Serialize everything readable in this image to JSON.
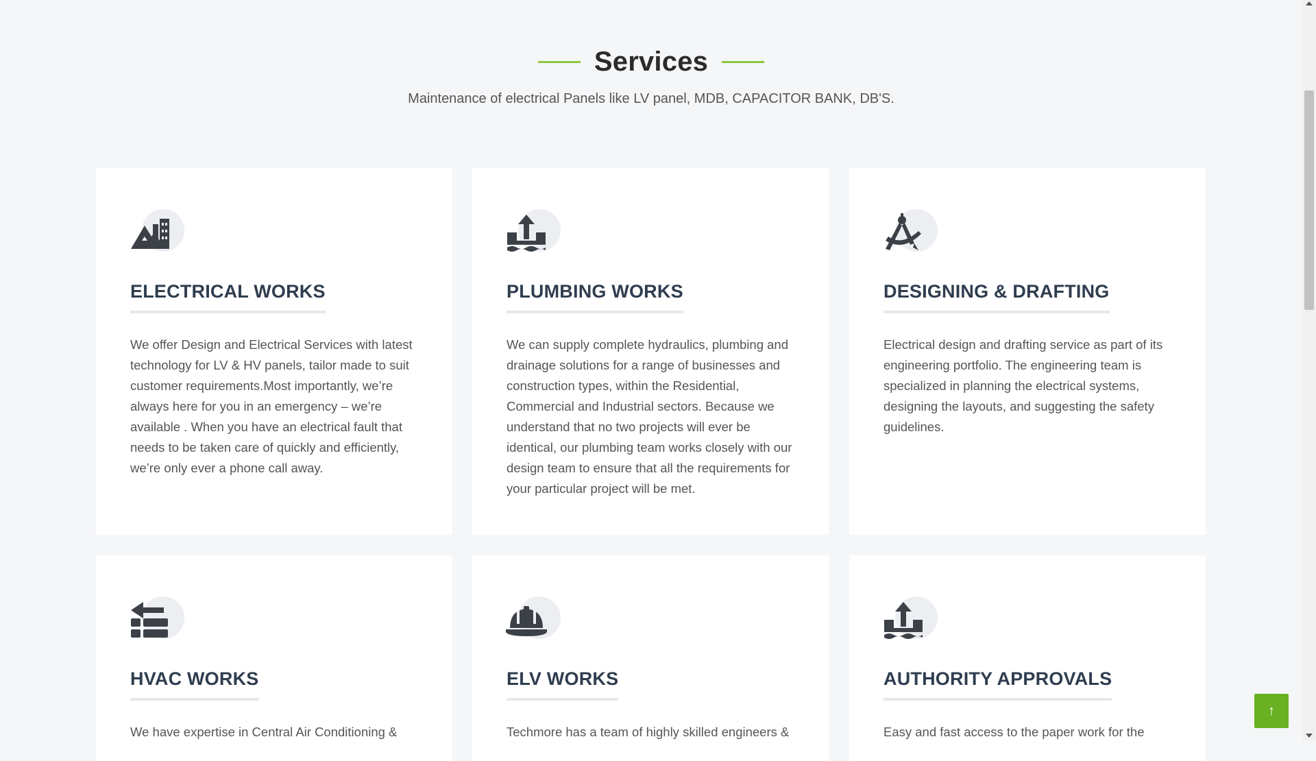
{
  "section": {
    "title": "Services",
    "subtitle": "Maintenance of electrical Panels like LV panel, MDB, CAPACITOR BANK, DB'S."
  },
  "services": [
    {
      "icon": "mountain-buildings-icon",
      "title": "ELECTRICAL WORKS",
      "description": "We offer Design and Electrical Services with latest technology for LV & HV panels, tailor made to suit customer requirements.Most importantly, we’re always here for you in an emergency – we’re available . When you have an electrical fault that needs to be taken care of quickly and efficiently, we’re only ever a phone call away."
    },
    {
      "icon": "water-upload-icon",
      "title": "PLUMBING WORKS",
      "description": "We can supply complete hydraulics, plumbing and drainage solutions for a range of businesses and construction types, within the Residential, Commercial and Industrial sectors. Because we understand that no two projects will ever be identical, our plumbing team works closely with our design team to ensure that all the requirements for your particular project will be met."
    },
    {
      "icon": "drafting-compass-icon",
      "title": "DESIGNING & DRAFTING",
      "description": "Electrical design and drafting service as part of its engineering portfolio. The engineering team is specialized in planning the electrical systems, designing the layouts, and suggesting the safety guidelines."
    },
    {
      "icon": "trowel-bricks-icon",
      "title": "HVAC WORKS",
      "description": "We have expertise in Central Air Conditioning &"
    },
    {
      "icon": "hard-hat-icon",
      "title": "ELV WORKS",
      "description": "Techmore has a team of highly skilled engineers &"
    },
    {
      "icon": "water-upload-icon",
      "title": "AUTHORITY APPROVALS",
      "description": "Easy and fast access to the paper work for the"
    }
  ],
  "back_to_top": {
    "icon": "arrow-up-icon",
    "glyph": "↑"
  },
  "colors": {
    "accent": "#8dc63f",
    "button": "#6ab023",
    "heading": "#2f3d4f"
  }
}
